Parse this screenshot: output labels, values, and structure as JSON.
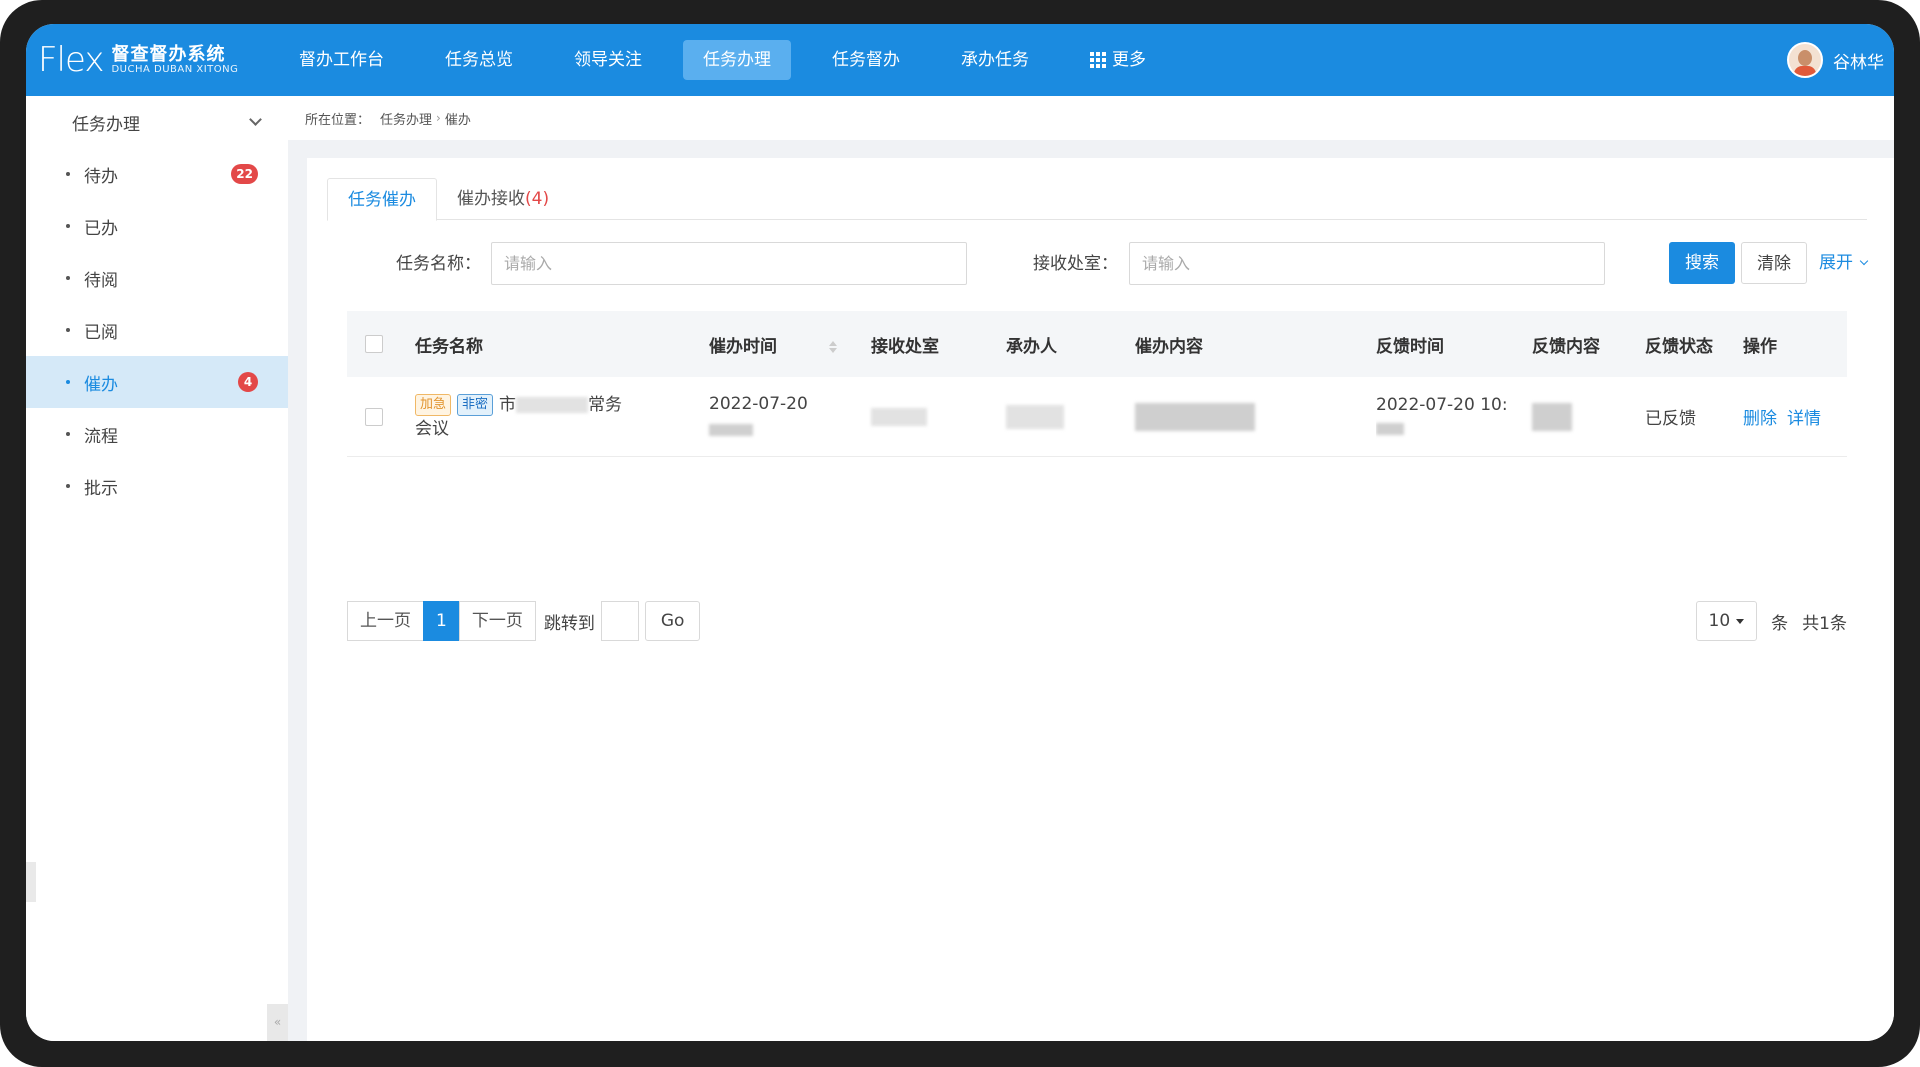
{
  "app": {
    "logo_mark": "Flex",
    "title": "督查督办系统",
    "subtitle": "DUCHA DUBAN XITONG"
  },
  "nav": {
    "items": [
      "督办工作台",
      "任务总览",
      "领导关注",
      "任务办理",
      "任务督办",
      "承办任务"
    ],
    "active": "任务办理",
    "more_label": "更多"
  },
  "user": {
    "name": "谷林华"
  },
  "sidebar": {
    "group_title": "任务办理",
    "items": [
      {
        "label": "待办",
        "badge": "22"
      },
      {
        "label": "已办",
        "badge": ""
      },
      {
        "label": "待阅",
        "badge": ""
      },
      {
        "label": "已阅",
        "badge": ""
      },
      {
        "label": "催办",
        "badge": "4"
      },
      {
        "label": "流程",
        "badge": ""
      },
      {
        "label": "批示",
        "badge": ""
      }
    ],
    "active": "催办",
    "collapse_glyph": "«"
  },
  "breadcrumb": {
    "prefix": "所在位置：",
    "level1": "任务办理",
    "sep": "›",
    "level2": "催办"
  },
  "tabs": {
    "tab1": "任务催办",
    "tab2_label": "催办接收",
    "tab2_count": "(4)"
  },
  "filters": {
    "task_name_label": "任务名称：",
    "task_name_placeholder": "请输入",
    "office_label": "接收处室：",
    "office_placeholder": "请输入",
    "search_btn": "搜索",
    "clear_btn": "清除",
    "expand_btn": "展开"
  },
  "table": {
    "columns": [
      "任务名称",
      "催办时间",
      "接收处室",
      "承办人",
      "催办内容",
      "反馈时间",
      "反馈内容",
      "反馈状态",
      "操作"
    ],
    "rows": [
      {
        "tag1": "加急",
        "tag2": "非密",
        "name_start": "市",
        "name_end": "常务",
        "name_line2": "会议",
        "urge_time": "2022-07-20",
        "feedback_time": "2022-07-20 10:",
        "status": "已反馈",
        "op_delete": "删除",
        "op_detail": "详情"
      }
    ]
  },
  "pagination": {
    "prev": "上一页",
    "current": "1",
    "next": "下一页",
    "jump_label": "跳转到",
    "go": "Go",
    "page_size": "10",
    "unit": "条",
    "total": "共1条"
  },
  "colors": {
    "primary": "#1b8be0",
    "badge": "#e34848",
    "topbar": "#1b8be0"
  }
}
